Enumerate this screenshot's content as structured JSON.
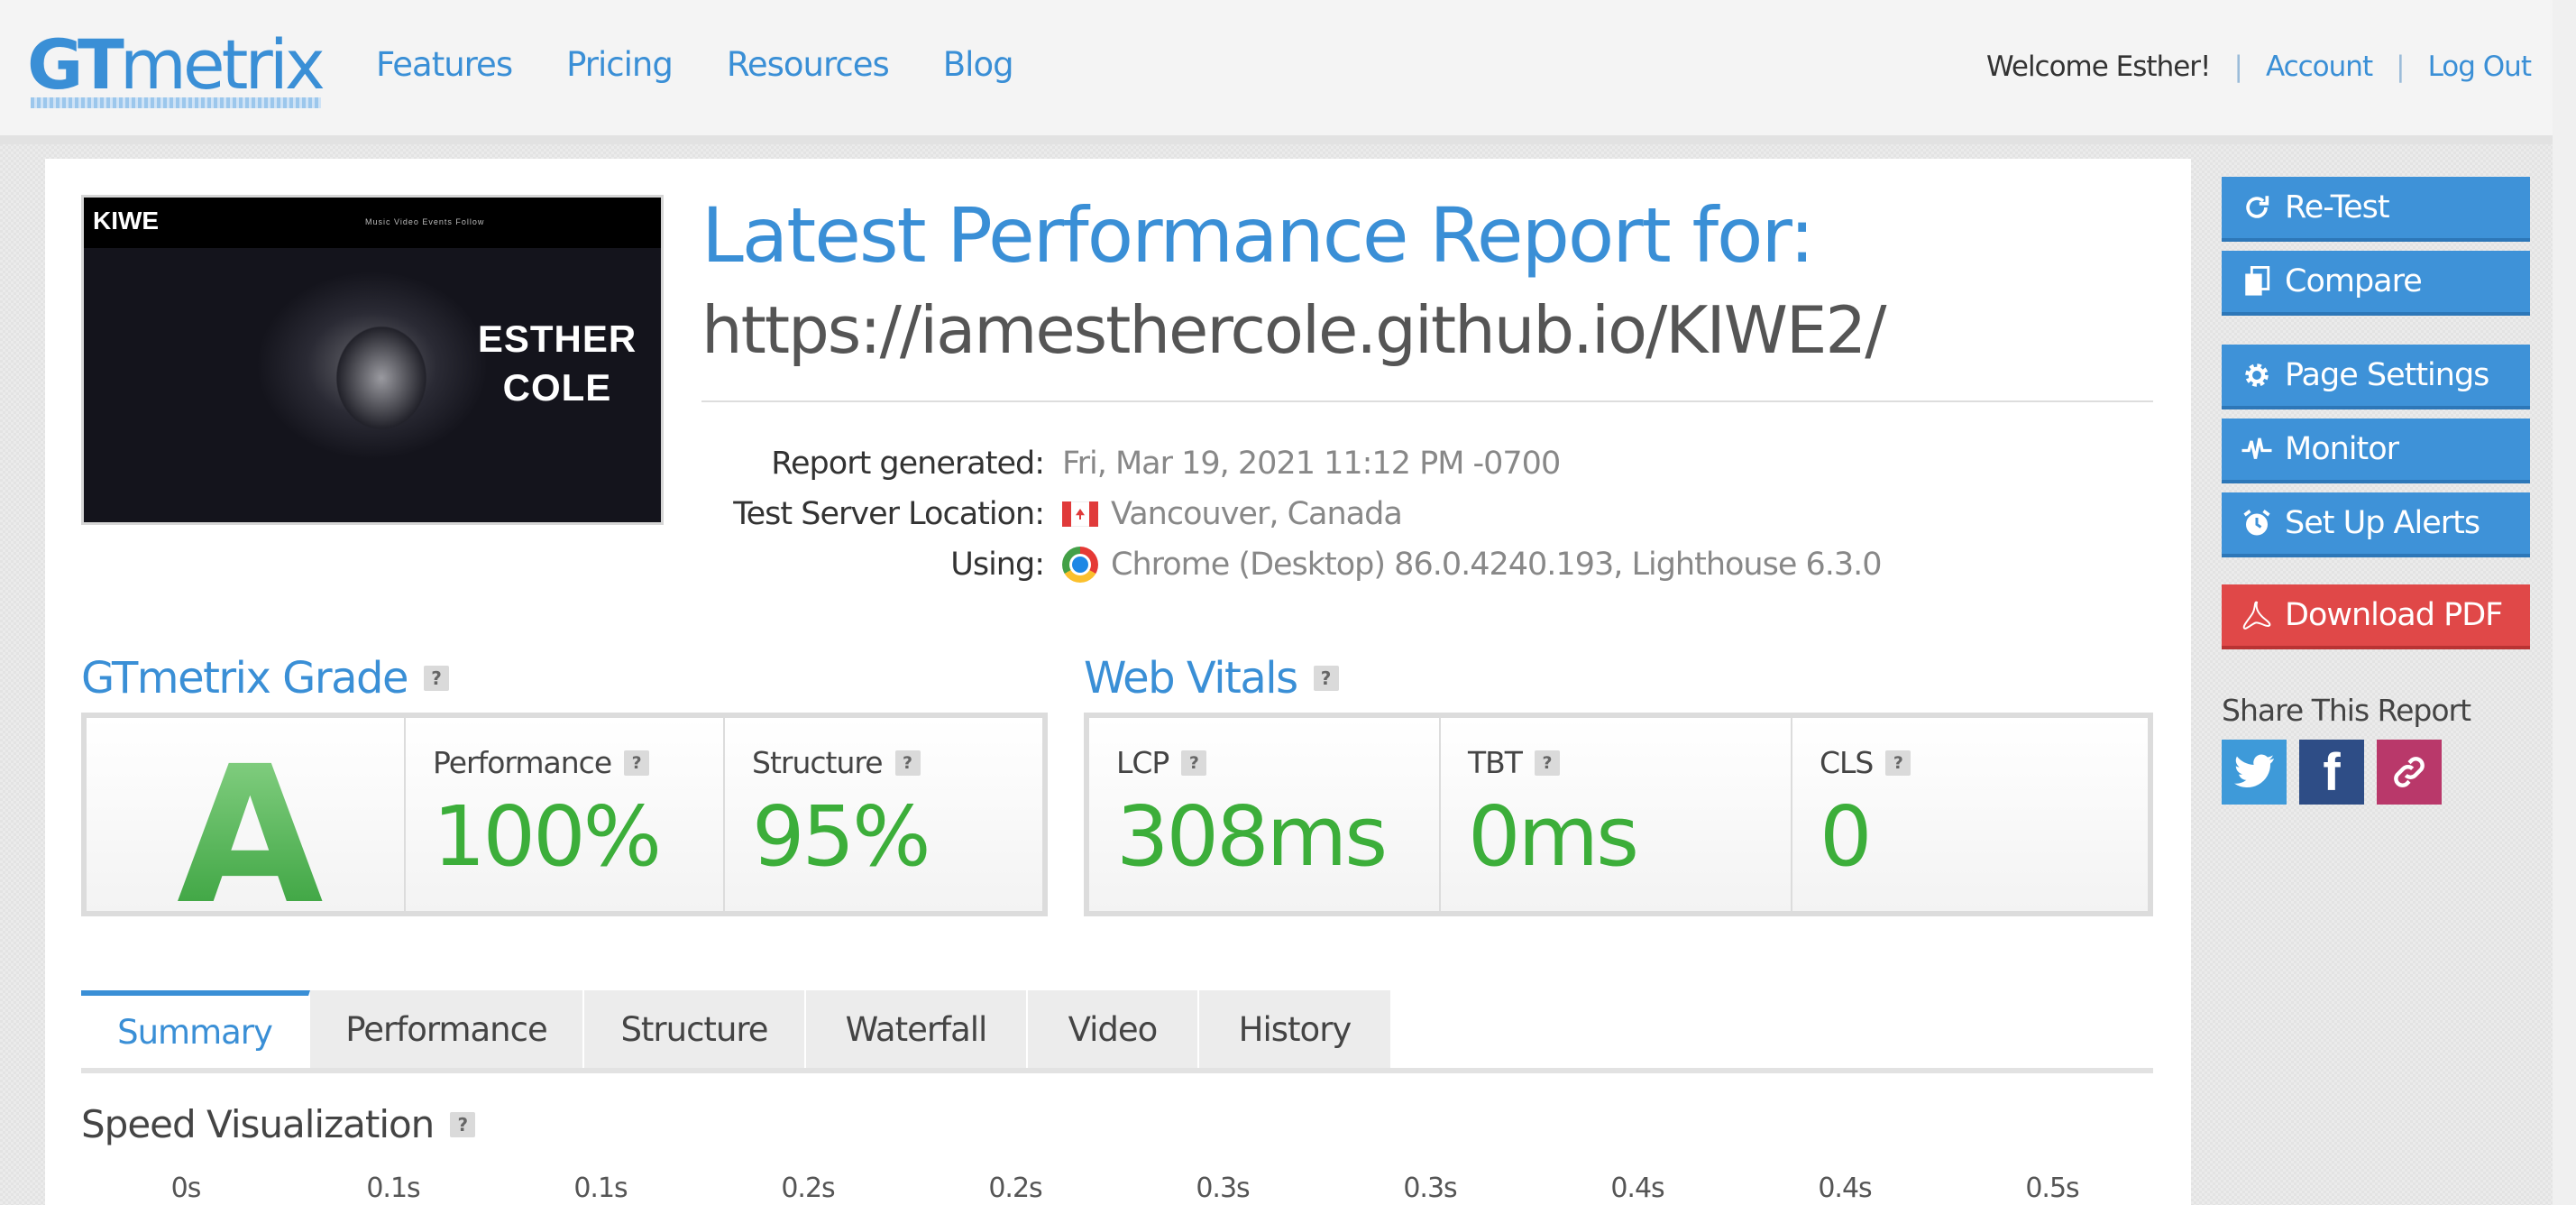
{
  "header": {
    "logo": {
      "gt": "GT",
      "rest": "metrix"
    },
    "nav": [
      "Features",
      "Pricing",
      "Resources",
      "Blog"
    ],
    "welcome": "Welcome Esther!",
    "account": "Account",
    "logout": "Log Out",
    "separator": "|"
  },
  "preview": {
    "site_logo": "KIWE",
    "menu": "Music  Video  Events  Follow",
    "title_line1": "ESTHER",
    "title_line2": "COLE"
  },
  "report": {
    "title": "Latest Performance Report for:",
    "url": "https://iamesthercole.github.io/KIWE2/",
    "meta": [
      {
        "label": "Report generated:",
        "value": "Fri, Mar 19, 2021 11:12 PM -0700",
        "icon": ""
      },
      {
        "label": "Test Server Location:",
        "value": "Vancouver, Canada",
        "icon": "canada-flag-icon"
      },
      {
        "label": "Using:",
        "value": "Chrome (Desktop) 86.0.4240.193, Lighthouse 6.3.0",
        "icon": "chrome-icon"
      }
    ]
  },
  "grade": {
    "title": "GTmetrix Grade",
    "help": "?",
    "letter": "A",
    "performance_label": "Performance",
    "performance_value": "100%",
    "structure_label": "Structure",
    "structure_value": "95%"
  },
  "vitals": {
    "title": "Web Vitals",
    "help": "?",
    "lcp_label": "LCP",
    "lcp_value": "308ms",
    "tbt_label": "TBT",
    "tbt_value": "0ms",
    "cls_label": "CLS",
    "cls_value": "0"
  },
  "tabs": [
    "Summary",
    "Performance",
    "Structure",
    "Waterfall",
    "Video",
    "History"
  ],
  "active_tab": "Summary",
  "speed": {
    "title": "Speed Visualization",
    "help": "?",
    "ticks": [
      "0s",
      "0.1s",
      "0.1s",
      "0.2s",
      "0.2s",
      "0.3s",
      "0.3s",
      "0.4s",
      "0.4s",
      "0.5s"
    ]
  },
  "sidebar": {
    "retest": "Re-Test",
    "compare": "Compare",
    "page_settings": "Page Settings",
    "monitor": "Monitor",
    "alerts": "Set Up Alerts",
    "pdf": "Download PDF",
    "share_title": "Share This Report",
    "facebook_glyph": "f"
  },
  "colors": {
    "brand_blue": "#3a8fd6",
    "grade_green": "#3cae3a",
    "pdf_red": "#e04848"
  }
}
